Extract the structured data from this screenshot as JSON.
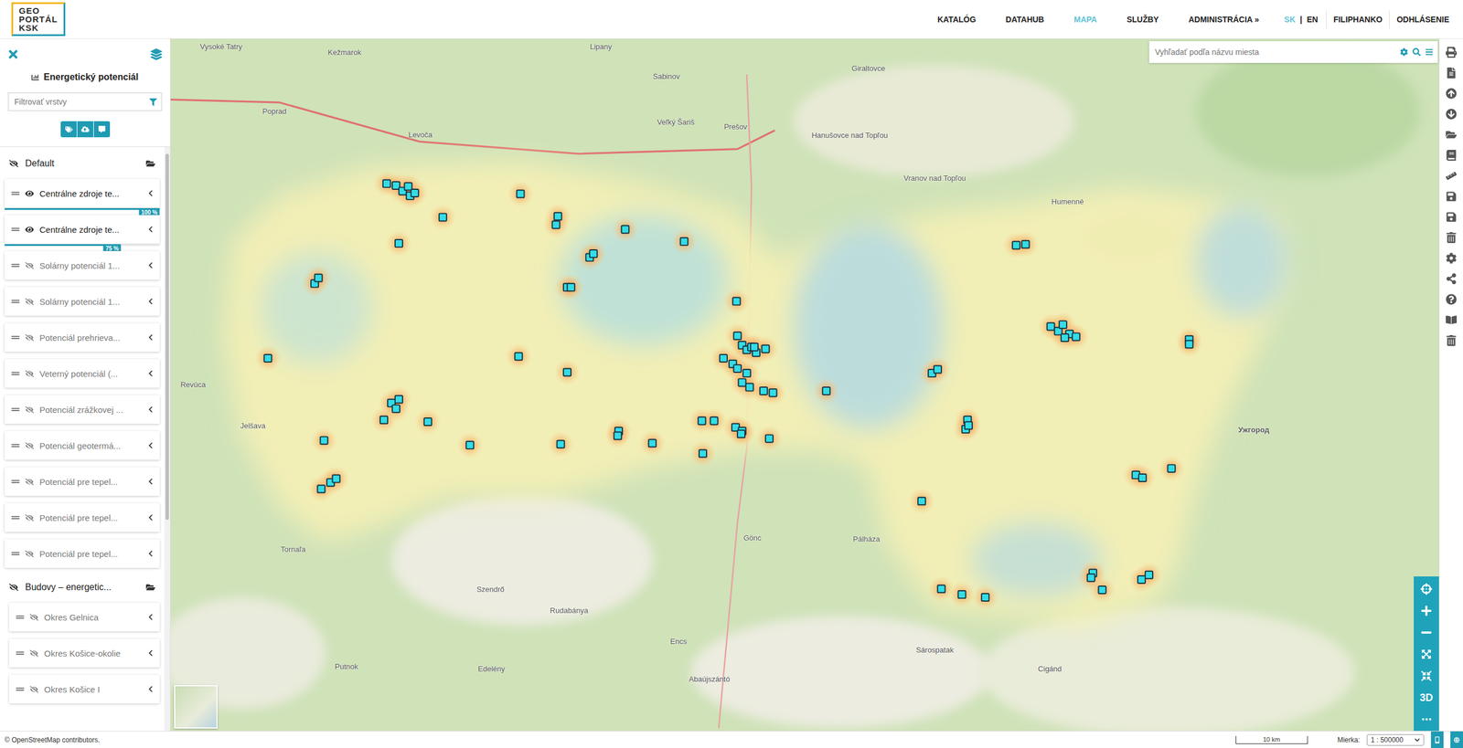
{
  "header": {
    "logo": [
      "GEO",
      "PORTÁL",
      "KSK"
    ],
    "nav": [
      {
        "label": "KATALÓG",
        "selected": false
      },
      {
        "label": "DATAHUB",
        "selected": false
      },
      {
        "label": "MAPA",
        "selected": true
      },
      {
        "label": "SLUŽBY",
        "selected": false
      },
      {
        "label": "ADMINISTRÁCIA »",
        "selected": false
      }
    ],
    "languages": [
      {
        "label": "SK",
        "selected": true
      },
      {
        "label": "EN",
        "selected": false
      }
    ],
    "language_separator": "|",
    "user": "FILIPHANKO",
    "logout": "ODHLÁSENIE"
  },
  "sidebar": {
    "title": "Energetický potenciál",
    "filter": {
      "placeholder": "Filtrovať vrstvy"
    },
    "groups": [
      {
        "name": "Default",
        "visible": false,
        "layers": [
          {
            "name": "Centrálne zdroje te...",
            "visible": true,
            "opacity": "100 %",
            "level": 1
          },
          {
            "name": "Centrálne zdroje te...",
            "visible": true,
            "opacity": "75 %",
            "level": 0.75
          },
          {
            "name": "Solárny potenciál 1...",
            "visible": false
          },
          {
            "name": "Solárny potenciál 1...",
            "visible": false
          },
          {
            "name": "Potenciál prehrieva...",
            "visible": false
          },
          {
            "name": "Veterný potenciál (...",
            "visible": false
          },
          {
            "name": "Potenciál zrážkovej ...",
            "visible": false
          },
          {
            "name": "Potenciál geotermá...",
            "visible": false
          },
          {
            "name": "Potenciál pre tepel...",
            "visible": false
          },
          {
            "name": "Potenciál pre tepel...",
            "visible": false
          },
          {
            "name": "Potenciál pre tepel...",
            "visible": false
          }
        ]
      },
      {
        "name": "Budovy – energetic...",
        "visible": false,
        "layers": [
          {
            "name": "Okres Gelnica",
            "visible": false
          },
          {
            "name": "Okres Košice-okolie",
            "visible": false
          },
          {
            "name": "Okres Košice I",
            "visible": false
          }
        ]
      }
    ]
  },
  "map": {
    "search": {
      "placeholder": "Vyhľadať podľa názvu miesta"
    },
    "places": [
      "Vysoké Tatry",
      "Kežmarok",
      "Poprad",
      "Levoča",
      "Sabinov",
      "Prešov",
      "Veľký Šariš",
      "Hanušovce nad Topľou",
      "Humenné",
      "Vranov nad Topľou",
      "Revúca",
      "Jelšava",
      "Tornaľa",
      "Szendrő",
      "Gönc",
      "Pálháza",
      "Encs",
      "Sárospatak",
      "Ужгород",
      "Cigánd",
      "Abaújszántó",
      "Rudabánya",
      "Edelény",
      "Putnok",
      "Giraltovce",
      "Lipany"
    ],
    "controls": [
      "3D",
      "⋯"
    ]
  },
  "status_bar": {
    "attribution": "© OpenStreetMap contributors.",
    "scale": "10 km",
    "zoom_label": "Mierka:",
    "zoom_value": "1 : 500000"
  }
}
